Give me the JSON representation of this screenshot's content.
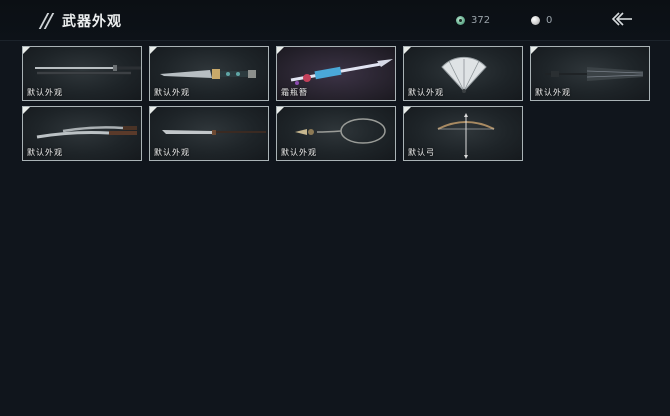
{
  "header": {
    "title": "武器外观",
    "currency_jade": "372",
    "currency_pearl": "0"
  },
  "cards": [
    {
      "label": "默认外观",
      "icon": "sword-icon"
    },
    {
      "label": "默认外观",
      "icon": "ornate-blade-icon"
    },
    {
      "label": "霜瓶簪",
      "icon": "glowing-spear-icon"
    },
    {
      "label": "默认外观",
      "icon": "war-fan-icon"
    },
    {
      "label": "默认外观",
      "icon": "umbrella-icon"
    },
    {
      "label": "默认外观",
      "icon": "twin-blades-icon"
    },
    {
      "label": "默认外观",
      "icon": "long-saber-icon"
    },
    {
      "label": "默认外观",
      "icon": "rope-dart-icon"
    },
    {
      "label": "默认弓",
      "icon": "bow-icon"
    }
  ]
}
